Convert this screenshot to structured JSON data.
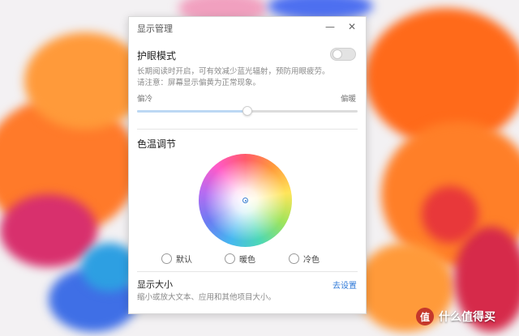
{
  "window": {
    "title": "显示管理",
    "minimize_glyph": "—",
    "close_glyph": "✕"
  },
  "eye_protection": {
    "title": "护眼模式",
    "toggle_on": false,
    "desc_line1": "长期阅读时开启，可有效减少蓝光辐射，预防用眼疲劳。",
    "desc_line2": "请注意：屏幕显示偏黄为正常现象。",
    "cold_label": "偏冷",
    "warm_label": "偏暖",
    "slider_value": 0.5
  },
  "color_temp": {
    "title": "色温调节",
    "options": [
      {
        "label": "默认",
        "selected": false
      },
      {
        "label": "暖色",
        "selected": false
      },
      {
        "label": "冷色",
        "selected": false
      }
    ]
  },
  "display_size": {
    "title": "显示大小",
    "link": "去设置",
    "desc": "缩小或放大文本、应用和其他项目大小。"
  },
  "watermark": {
    "logo": "值",
    "text": "什么值得买"
  },
  "colors": {
    "accent": "#2f7ad8",
    "wallpaper_orange": "#ff7a1a",
    "wallpaper_magenta": "#d4276e",
    "wallpaper_blue": "#2a5fe8"
  }
}
